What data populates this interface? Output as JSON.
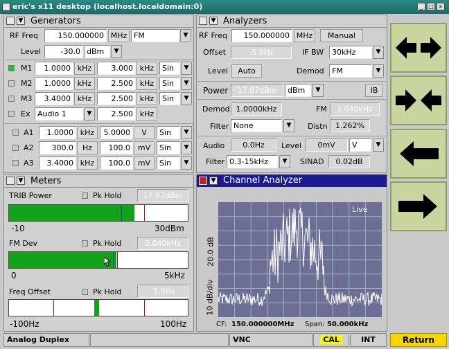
{
  "window": {
    "title": "eric's x11 desktop (localhost.localdomain:0)",
    "min_glyph": "_",
    "max_glyph": "□",
    "close_glyph": "×"
  },
  "generators": {
    "title": "Generators",
    "rf_freq_label": "RF Freq",
    "rf_freq_value": "150.000000",
    "rf_freq_unit": "MHz",
    "mod_mode": "FM",
    "level_label": "Level",
    "level_value": "-30.0",
    "level_unit": "dBm",
    "mod_rows": [
      {
        "label": "M1",
        "freq": "1.0000",
        "freq_unit": "kHz",
        "dev": "3.000",
        "dev_unit": "kHz",
        "wave": "Sin"
      },
      {
        "label": "M2",
        "freq": "1.0000",
        "freq_unit": "kHz",
        "dev": "2.500",
        "dev_unit": "kHz",
        "wave": "Sin"
      },
      {
        "label": "M3",
        "freq": "3.4000",
        "freq_unit": "kHz",
        "dev": "2.500",
        "dev_unit": "kHz",
        "wave": "Sin"
      }
    ],
    "ex": {
      "label": "Ex",
      "source": "Audio 1",
      "dev": "2.500",
      "dev_unit": "kHz"
    },
    "audio_rows": [
      {
        "label": "A1",
        "freq": "1.0000",
        "freq_unit": "kHz",
        "amp": "5.0000",
        "amp_unit": "V",
        "wave": "Sin"
      },
      {
        "label": "A2",
        "freq": "300.0",
        "freq_unit": "Hz",
        "amp": "100.0",
        "amp_unit": "mV",
        "wave": "Sin"
      },
      {
        "label": "A3",
        "freq": "3.4000",
        "freq_unit": "kHz",
        "amp": "100.0",
        "amp_unit": "mV",
        "wave": "Sin"
      }
    ]
  },
  "analyzers": {
    "title": "Analyzers",
    "rf_freq_label": "RF Freq",
    "rf_freq_value": "150.000000",
    "rf_freq_unit": "MHz",
    "manual_label": "Manual",
    "offset_label": "Offset",
    "offset_value": "-5.9Hz",
    "ifbw_label": "IF BW",
    "ifbw_value": "30kHz",
    "level_label": "Level",
    "auto_label": "Auto",
    "demod_label": "Demod",
    "demod_value": "FM",
    "power_label": "Power",
    "power_value": "17.87dBm",
    "power_unit": "dBm",
    "ib_label": "IB",
    "demod2_label": "Demod",
    "demod2_value": "1.0000kHz",
    "fm_label": "FM",
    "fm_value": "3.040kHz",
    "filter_label": "Filter",
    "filter_value": "None",
    "distn_label": "Distn",
    "distn_value": "1.262%",
    "audio_label": "Audio",
    "audio_value": "0.0Hz",
    "alevel_label": "Level",
    "alevel_value": "0mV",
    "alevel_unit": "V",
    "afilter_label": "Filter",
    "afilter_value": "0.3-15kHz",
    "sinad_label": "SINAD",
    "sinad_value": "0.02dB"
  },
  "meters": {
    "title": "Meters",
    "items": [
      {
        "name": "TRIB Power",
        "pk_label": "Pk Hold",
        "value": "17.87dBm",
        "min": "-10",
        "max": "30dBm",
        "fill": 0.7
      },
      {
        "name": "FM Dev",
        "pk_label": "Pk Hold",
        "value": "3.040kHz",
        "min": "0",
        "max": "5kHz",
        "fill": 0.6
      },
      {
        "name": "Freq Offset",
        "pk_label": "Pk Hold",
        "value": "-5.9Hz",
        "min": "-100Hz",
        "max": "100Hz",
        "fill": 0.5
      }
    ]
  },
  "channel": {
    "title": "Channel Analyzer",
    "live": "Live",
    "ylabel_scale": "20.0 dB",
    "ylabel_div": "10 dB/div",
    "cf_label": "CF:",
    "cf_value": "150.000000MHz",
    "span_label": "Span:",
    "span_value": "50.000kHz"
  },
  "status": {
    "mode": "Analog Duplex",
    "vnc": "VNC",
    "cal": "CAL",
    "int": "INT",
    "return_label": "Return"
  },
  "colors": {
    "accent_green": "#12a31a",
    "warn_yellow": "#f7f700",
    "plot_bg": "#6c6f93",
    "title_teal": "#1f7a74"
  }
}
